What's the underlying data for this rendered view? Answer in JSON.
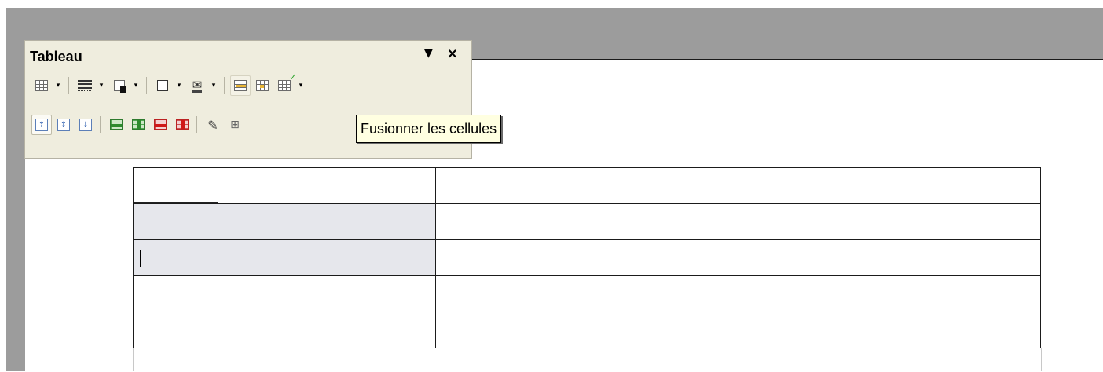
{
  "toolbar": {
    "title": "Tableau",
    "menu_glyph": "▼",
    "close_glyph": "×",
    "dropdown_glyph": "▾",
    "row1_icons": [
      "table-insert-icon",
      "line-style-icon",
      "border-color-icon",
      "borders-icon",
      "fill-color-icon",
      "merge-cells-icon",
      "split-cells-icon",
      "autoformat-icon"
    ],
    "row2_icons": [
      "valign-top-icon",
      "valign-center-icon",
      "valign-bottom-icon",
      "insert-rows-icon",
      "insert-columns-icon",
      "delete-rows-icon",
      "delete-columns-icon",
      "table-properties-icon"
    ],
    "partial_glyph_1": "⊞",
    "partial_glyph_2": "╧"
  },
  "tooltip": {
    "text": "Fusionner les cellules"
  },
  "document_table": {
    "rows": 5,
    "columns": 3,
    "selected_cells": [
      [
        1,
        0
      ],
      [
        2,
        0
      ]
    ],
    "cursor_cell": [
      2,
      0
    ]
  },
  "colors": {
    "background_gray": "#9c9c9c",
    "toolbar_bg": "#efedde",
    "selection": "#e6e7ec",
    "tooltip_bg": "#ffffe1"
  }
}
